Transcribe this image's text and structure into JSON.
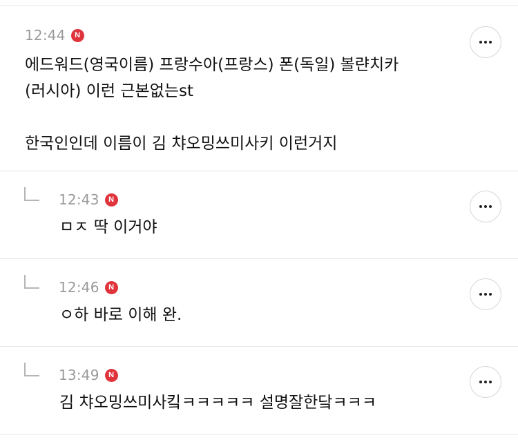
{
  "comments": [
    {
      "time": "12:44",
      "badge": "N",
      "text": "에드워드(영국이름) 프랑수아(프랑스) 폰(독일) 볼랸치카\n(러시아) 이런 근본없는st\n\n한국인인데 이름이 김 챠오밍쓰미사키 이런거지"
    },
    {
      "time": "12:43",
      "badge": "N",
      "text": "ㅁㅈ 딱 이거야"
    },
    {
      "time": "12:46",
      "badge": "N",
      "text": "ㅇ하 바로 이해 완."
    },
    {
      "time": "13:49",
      "badge": "N",
      "text": "김 챠오밍쓰미사킼ㅋㅋㅋㅋㅋ 설명잘한닼ㅋㅋㅋ"
    }
  ],
  "icons": {
    "more": "more-horizontal-icon",
    "reply": "reply-arrow-icon"
  },
  "colors": {
    "badge": "#e0343c",
    "time": "#9a9a9a",
    "divider": "#e6e6e6"
  }
}
